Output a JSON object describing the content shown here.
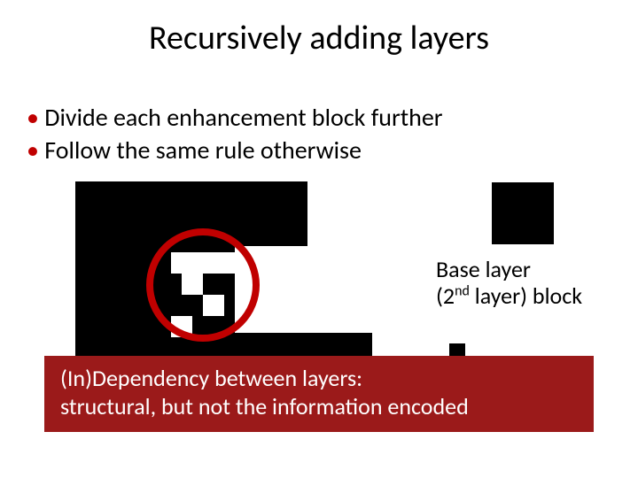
{
  "title": "Recursively adding layers",
  "bullets": {
    "b1": "Divide each enhancement block further",
    "b2": "Follow the same rule otherwise"
  },
  "label": {
    "line1": "Base layer",
    "line2_prefix": "(2",
    "line2_sup": "nd",
    "line2_suffix": " layer) block"
  },
  "callout": {
    "line1": "(In)Dependency between layers:",
    "line2": "structural, but not the information encoded"
  },
  "colors": {
    "accent": "#c00000",
    "callout_bg": "#9b1a1a"
  }
}
